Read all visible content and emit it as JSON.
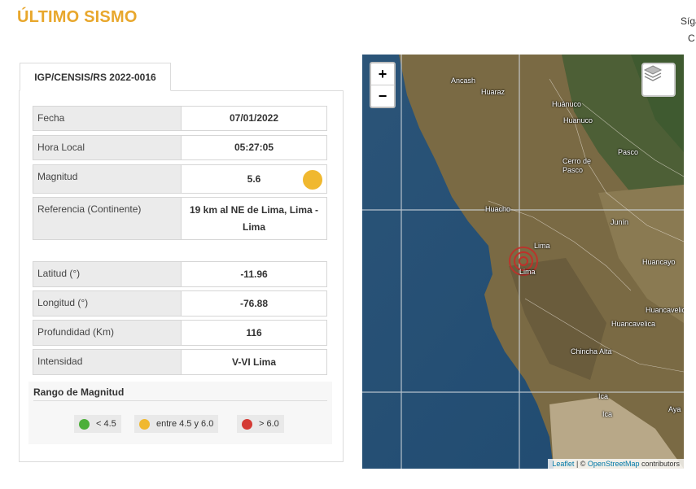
{
  "header": {
    "title": "ÚLTIMO SISMO",
    "cut_text_1": "Síga",
    "cut_text_2": "C"
  },
  "report": {
    "tab_label": "IGP/CENSIS/RS 2022-0016",
    "fields": [
      {
        "label": "Fecha",
        "value": "07/01/2022"
      },
      {
        "label": "Hora Local",
        "value": "05:27:05"
      },
      {
        "label": "Magnitud",
        "value": "5.6"
      },
      {
        "label": "Referencia (Continente)",
        "value": "19 km al NE de Lima, Lima - Lima"
      },
      {
        "label": "Latitud (°)",
        "value": "-11.96"
      },
      {
        "label": "Longitud (°)",
        "value": "-76.88"
      },
      {
        "label": "Profundidad (Km)",
        "value": "116"
      },
      {
        "label": "Intensidad",
        "value": "V-VI Lima"
      }
    ],
    "magnitude_color": "#f0b82f"
  },
  "legend": {
    "title": "Rango de Magnitud",
    "items": [
      {
        "label": "< 4.5",
        "color": "#4caf3a"
      },
      {
        "label": "entre 4.5 y 6.0",
        "color": "#f0b82f"
      },
      {
        "label": "> 6.0",
        "color": "#d43a34"
      }
    ]
  },
  "map": {
    "zoom_in": "+",
    "zoom_out": "−",
    "layers_icon": "layers-icon",
    "attribution": {
      "leaflet": "Leaflet",
      "sep": " | © ",
      "osm": "OpenStreetMap",
      "suffix": " contributors"
    },
    "places": [
      "Ancash",
      "Huaraz",
      "Huánuco",
      "Huanuco",
      "Cerro de",
      "Pasco",
      "Pasco",
      "Huacho",
      "Junín",
      "Lima",
      "Lima",
      "Huancayo",
      "Huancavelica",
      "Huancavelica",
      "Chincha Alta",
      "Ica",
      "Ica",
      "Aya"
    ],
    "epicenter_color": "#c0302a"
  }
}
